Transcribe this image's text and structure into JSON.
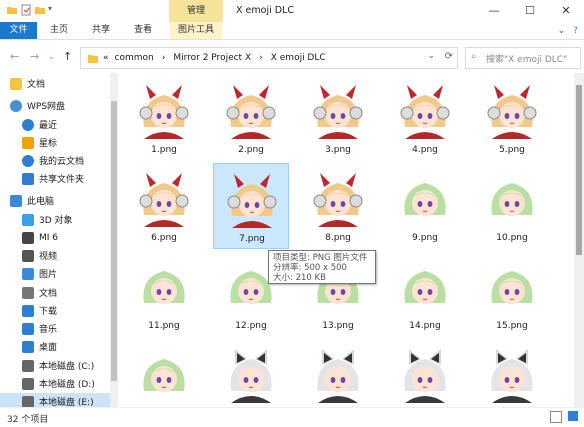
{
  "window": {
    "title": "X emoji DLC",
    "context_tab": "管理",
    "controls": {
      "minimize": "—",
      "maximize": "☐",
      "close": "✕"
    }
  },
  "ribbon": {
    "file": "文件",
    "tabs": [
      "主页",
      "共享",
      "查看",
      "图片工具"
    ],
    "expand": "⌄",
    "help": "?"
  },
  "address": {
    "prefix": "«",
    "crumbs": [
      "common",
      "Mirror 2 Project X",
      "X emoji DLC"
    ],
    "separator": "›",
    "search_placeholder": "搜索\"X emoji DLC\""
  },
  "sidebar": {
    "items": [
      {
        "label": "文档",
        "icon": "folder-icon",
        "color": "#f5c542"
      },
      {
        "label": "WPS网盘",
        "icon": "cloud-icon",
        "color": "#4a90d9"
      },
      {
        "label": "最近",
        "icon": "clock-icon",
        "color": "#2f7fd1"
      },
      {
        "label": "星标",
        "icon": "star-icon",
        "color": "#f0a400"
      },
      {
        "label": "我的云文档",
        "icon": "cloud-doc-icon",
        "color": "#2f7fd1"
      },
      {
        "label": "共享文件夹",
        "icon": "share-folder-icon",
        "color": "#2f7fd1"
      },
      {
        "label": "此电脑",
        "icon": "computer-icon",
        "color": "#3a8ad6"
      },
      {
        "label": "3D 对象",
        "icon": "cube-icon",
        "color": "#3aa0e6"
      },
      {
        "label": "MI 6",
        "icon": "phone-icon",
        "color": "#444444"
      },
      {
        "label": "视频",
        "icon": "video-icon",
        "color": "#555555"
      },
      {
        "label": "图片",
        "icon": "picture-icon",
        "color": "#3a8ad6"
      },
      {
        "label": "文档",
        "icon": "document-icon",
        "color": "#777777"
      },
      {
        "label": "下载",
        "icon": "download-icon",
        "color": "#2f7fd1"
      },
      {
        "label": "音乐",
        "icon": "music-icon",
        "color": "#2f7fd1"
      },
      {
        "label": "桌面",
        "icon": "desktop-icon",
        "color": "#2f7fd1"
      },
      {
        "label": "本地磁盘 (C:)",
        "icon": "drive-icon",
        "color": "#666666"
      },
      {
        "label": "本地磁盘 (D:)",
        "icon": "drive-icon",
        "color": "#666666"
      },
      {
        "label": "本地磁盘 (E:)",
        "icon": "drive-icon",
        "color": "#666666"
      }
    ]
  },
  "files": [
    {
      "name": "1.png",
      "hair": "#f2c98a",
      "style": "horns"
    },
    {
      "name": "2.png",
      "hair": "#f2c98a",
      "style": "horns"
    },
    {
      "name": "3.png",
      "hair": "#f2c98a",
      "style": "horns"
    },
    {
      "name": "4.png",
      "hair": "#f2c98a",
      "style": "horns"
    },
    {
      "name": "5.png",
      "hair": "#f2c98a",
      "style": "horns"
    },
    {
      "name": "6.png",
      "hair": "#f2c98a",
      "style": "horns"
    },
    {
      "name": "7.png",
      "hair": "#f2c98a",
      "style": "horns"
    },
    {
      "name": "8.png",
      "hair": "#f2c98a",
      "style": "horns"
    },
    {
      "name": "9.png",
      "hair": "#b9dfa2",
      "style": "green"
    },
    {
      "name": "10.png",
      "hair": "#b9dfa2",
      "style": "green"
    },
    {
      "name": "11.png",
      "hair": "#b9dfa2",
      "style": "green"
    },
    {
      "name": "12.png",
      "hair": "#b9dfa2",
      "style": "green"
    },
    {
      "name": "13.png",
      "hair": "#b9dfa2",
      "style": "green"
    },
    {
      "name": "14.png",
      "hair": "#b9dfa2",
      "style": "green"
    },
    {
      "name": "15.png",
      "hair": "#b9dfa2",
      "style": "green"
    },
    {
      "name": "",
      "hair": "#b9dfa2",
      "style": "green"
    },
    {
      "name": "",
      "hair": "#e4e4e8",
      "style": "cat"
    },
    {
      "name": "",
      "hair": "#e4e4e8",
      "style": "cat"
    },
    {
      "name": "",
      "hair": "#e4e4e8",
      "style": "cat"
    },
    {
      "name": "",
      "hair": "#e4e4e8",
      "style": "cat"
    }
  ],
  "tooltip": {
    "type": "项目类型: PNG 图片文件",
    "dimensions": "分辨率: 500 x 500",
    "size": "大小: 210 KB"
  },
  "status": {
    "count": "32 个项目"
  },
  "colors": {
    "accent": "#1979ca",
    "selection": "#cce8ff",
    "manage_tab": "#f6e39a"
  }
}
